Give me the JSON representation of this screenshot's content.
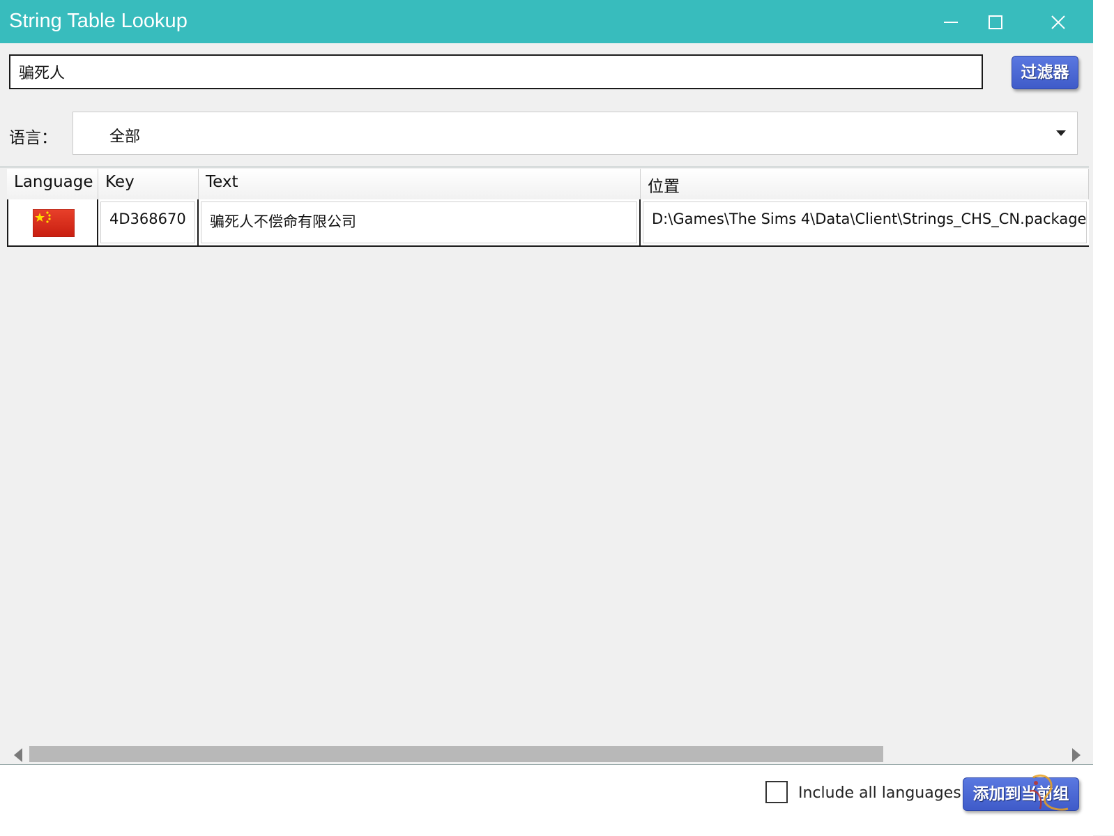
{
  "window": {
    "title": "String Table Lookup",
    "controls": {
      "minimize": "minimize",
      "maximize": "maximize",
      "close": "close"
    }
  },
  "search": {
    "value": "骗死人"
  },
  "filter_button": {
    "label": "过滤器"
  },
  "language_filter": {
    "label": "语言：",
    "selected": "全部"
  },
  "table": {
    "columns": [
      "Language",
      "Key",
      "Text",
      "位置"
    ],
    "rows": [
      {
        "language_icon": "china-flag-icon",
        "key": "4D368670",
        "text": "骗死人不偿命有限公司",
        "location": "D:\\Games\\The Sims 4\\Data\\Client\\Strings_CHS_CN.package"
      }
    ]
  },
  "footer": {
    "include_all_languages": {
      "label": "Include all languages",
      "checked": false
    },
    "add_button": {
      "label": "添加到当前组"
    }
  },
  "colors": {
    "titlebar": "#38bcbd",
    "button": "#4a66d4",
    "background": "#f0f0f0"
  }
}
